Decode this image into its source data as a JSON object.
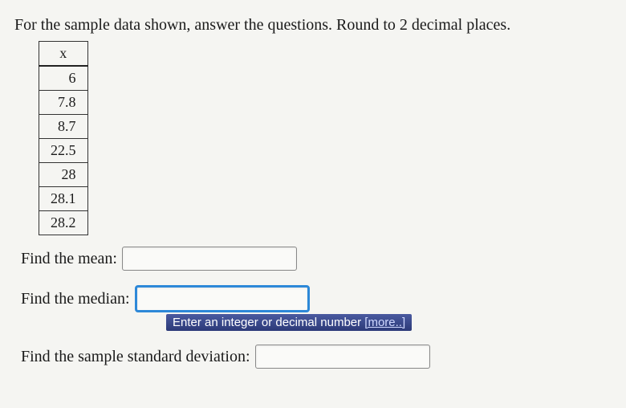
{
  "prompt": "For the sample data shown, answer the questions. Round to 2 decimal places.",
  "table": {
    "header": "x",
    "values": [
      "6",
      "7.8",
      "8.7",
      "22.5",
      "28",
      "28.1",
      "28.2"
    ]
  },
  "questions": {
    "mean": {
      "label": "Find the mean:",
      "value": ""
    },
    "median": {
      "label": "Find the median:",
      "value": "",
      "hint_text": "Enter an integer or decimal number ",
      "hint_more": "[more..]"
    },
    "sd": {
      "label": "Find the sample standard deviation:",
      "value": ""
    }
  }
}
